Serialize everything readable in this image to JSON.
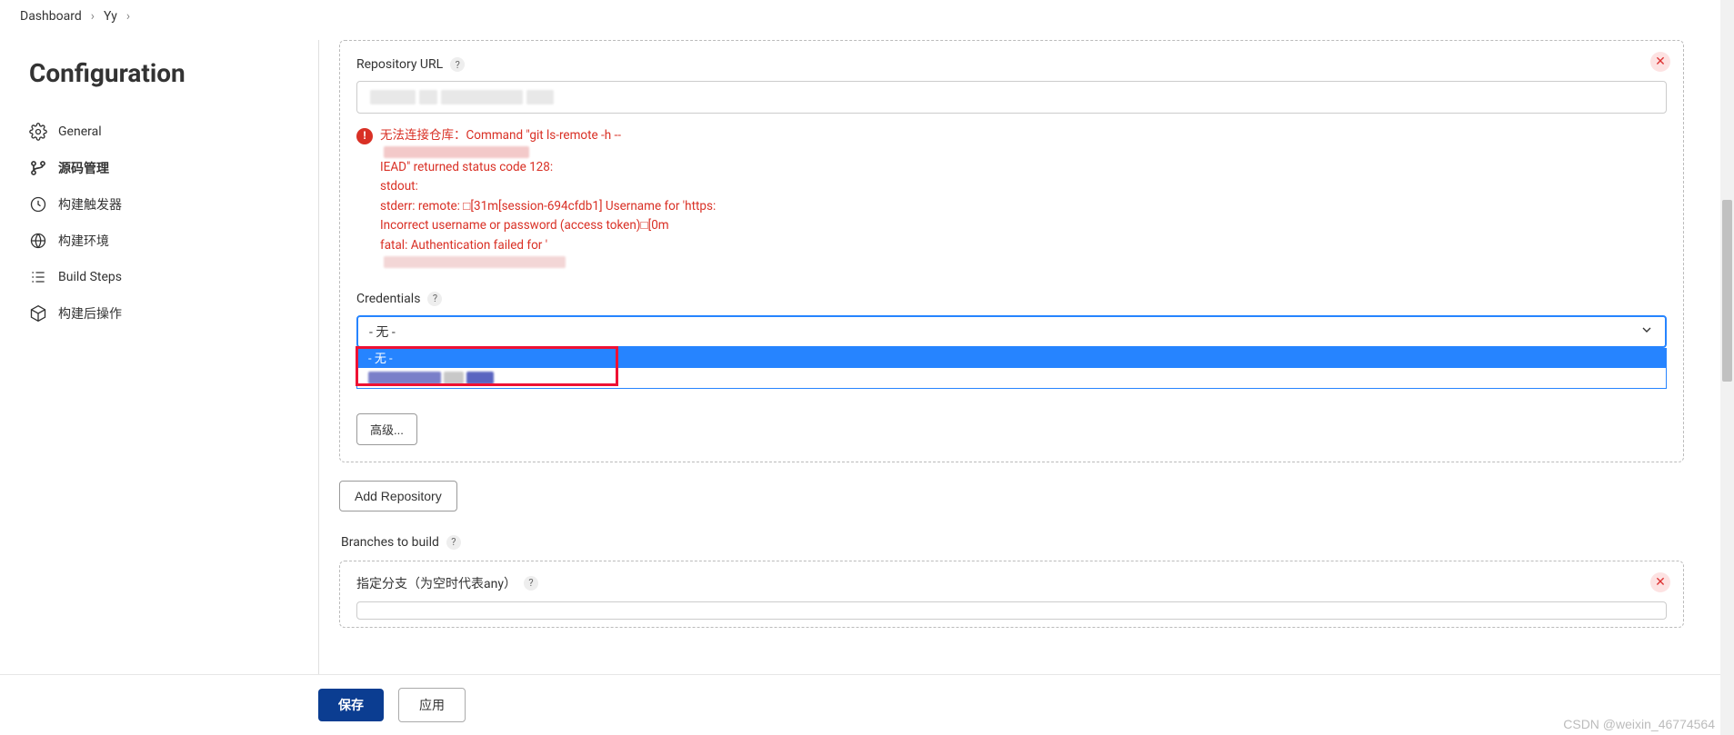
{
  "breadcrumb": {
    "items": [
      "Dashboard",
      "Yy"
    ]
  },
  "sidebar": {
    "heading": "Configuration",
    "items": [
      {
        "label": "General",
        "active": false
      },
      {
        "label": "源码管理",
        "active": true
      },
      {
        "label": "构建触发器",
        "active": false
      },
      {
        "label": "构建环境",
        "active": false
      },
      {
        "label": "Build Steps",
        "active": false
      },
      {
        "label": "构建后操作",
        "active": false
      }
    ]
  },
  "repo": {
    "url_label": "Repository URL",
    "url_value": "",
    "error_prefix": "无法连接仓库：Command \"git ls-remote -h --",
    "error_suffix": "IEAD\" returned status code 128:",
    "error_line2": "stdout:",
    "error_line3_a": "stderr: remote: □[31m[session-694cfdb1] Username for 'https:",
    "error_line3_b": "Incorrect username or password (access token)□[0m",
    "error_line4": "fatal: Authentication failed for '",
    "credentials_label": "Credentials",
    "credentials_value": "- 无 -",
    "dropdown_options": [
      "- 无 -",
      ""
    ],
    "advanced_button": "高级..."
  },
  "add_repo_button": "Add Repository",
  "branches": {
    "section_label": "Branches to build",
    "field_label": "指定分支（为空时代表any）"
  },
  "bottom": {
    "save": "保存",
    "apply": "应用"
  },
  "watermark": "CSDN @weixin_46774564"
}
